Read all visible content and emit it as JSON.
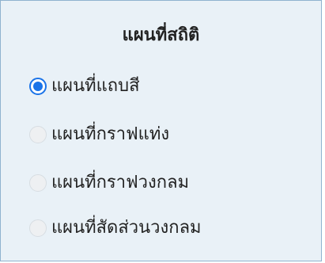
{
  "panel": {
    "title": "แผนที่สถิติ",
    "accent_color": "#1a73e8",
    "background_color": "#e9f1f7",
    "border_color": "#8fb3cf",
    "options": [
      {
        "label": "แผนที่แถบสี",
        "selected": true
      },
      {
        "label": "แผนที่กราฟแท่ง",
        "selected": false
      },
      {
        "label": "แผนที่กราฟวงกลม",
        "selected": false
      },
      {
        "label": "แผนที่สัดส่วนวงกลม",
        "selected": false
      }
    ]
  }
}
